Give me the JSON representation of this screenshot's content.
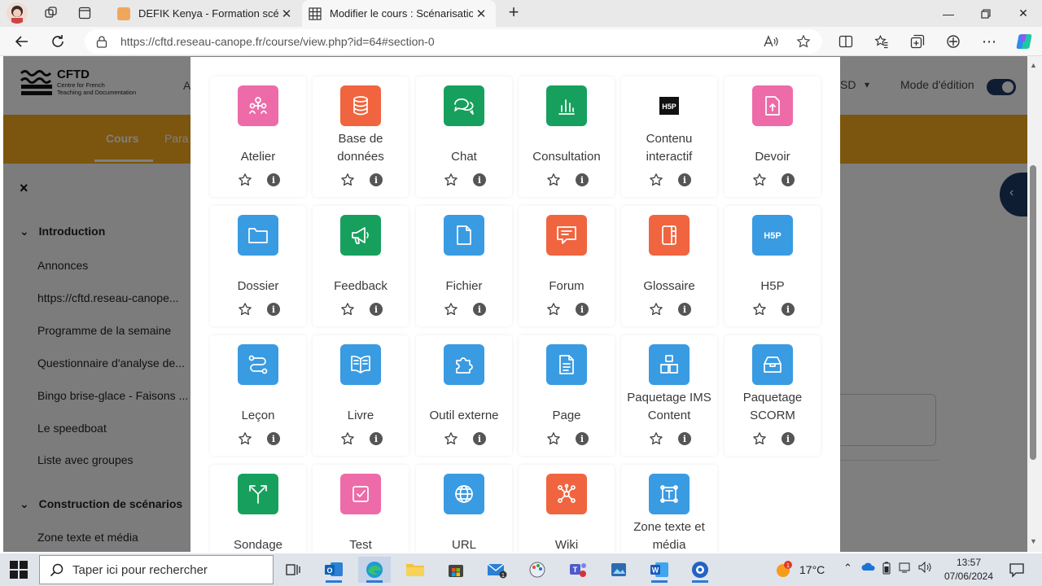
{
  "browser": {
    "tabs": [
      {
        "title": "DEFIK Kenya - Formation scénari"
      },
      {
        "title": "Modifier le cours : Scénarisation"
      }
    ],
    "url": "https://cftd.reseau-canope.fr/course/view.php?id=64#section-0"
  },
  "site": {
    "logo_title": "CFTD",
    "logo_sub1": "Centre for French",
    "logo_sub2": "Teaching and Documentation",
    "header_partial_a": "A",
    "header_partial_sd": "SD",
    "edit_mode_label": "Mode d'édition",
    "nav": {
      "cours": "Cours",
      "para": "Para"
    }
  },
  "sidebar": {
    "close": "×",
    "sections": [
      {
        "title": "Introduction",
        "items": [
          "Annonces",
          "https://cftd.reseau-canope...",
          "Programme de la semaine",
          "Questionnaire d'analyse de...",
          "Bingo brise-glace - Faisons ...",
          "Le speedboat",
          "Liste avec groupes"
        ]
      },
      {
        "title": "Construction de scénarios",
        "items": [
          "Zone texte et média"
        ]
      }
    ]
  },
  "activities": [
    {
      "name": "Atelier",
      "color": "#ed6ba9",
      "icon": "workshop-icon"
    },
    {
      "name": "Base de données",
      "color": "#f0643f",
      "icon": "database-icon"
    },
    {
      "name": "Chat",
      "color": "#17a05d",
      "icon": "chat-icon"
    },
    {
      "name": "Consultation",
      "color": "#17a05d",
      "icon": "bar-chart-icon"
    },
    {
      "name": "Contenu interactif",
      "color": "#ffffff",
      "icon": "h5p-dark-icon"
    },
    {
      "name": "Devoir",
      "color": "#ed6ba9",
      "icon": "assignment-upload-icon"
    },
    {
      "name": "Dossier",
      "color": "#399be2",
      "icon": "folder-icon"
    },
    {
      "name": "Feedback",
      "color": "#17a05d",
      "icon": "megaphone-icon"
    },
    {
      "name": "Fichier",
      "color": "#399be2",
      "icon": "file-icon"
    },
    {
      "name": "Forum",
      "color": "#f0643f",
      "icon": "forum-icon"
    },
    {
      "name": "Glossaire",
      "color": "#f0643f",
      "icon": "glossary-icon"
    },
    {
      "name": "H5P",
      "color": "#399be2",
      "icon": "h5p-icon"
    },
    {
      "name": "Leçon",
      "color": "#399be2",
      "icon": "lesson-icon"
    },
    {
      "name": "Livre",
      "color": "#399be2",
      "icon": "book-icon"
    },
    {
      "name": "Outil externe",
      "color": "#399be2",
      "icon": "puzzle-icon"
    },
    {
      "name": "Page",
      "color": "#399be2",
      "icon": "page-icon"
    },
    {
      "name": "Paquetage IMS Content",
      "color": "#399be2",
      "icon": "ims-package-icon"
    },
    {
      "name": "Paquetage SCORM",
      "color": "#399be2",
      "icon": "scorm-package-icon"
    },
    {
      "name": "Sondage",
      "color": "#17a05d",
      "icon": "choice-icon"
    },
    {
      "name": "Test",
      "color": "#ed6ba9",
      "icon": "quiz-icon"
    },
    {
      "name": "URL",
      "color": "#399be2",
      "icon": "globe-icon"
    },
    {
      "name": "Wiki",
      "color": "#f0643f",
      "icon": "wiki-icon"
    },
    {
      "name": "Zone texte et média",
      "color": "#399be2",
      "icon": "text-media-icon"
    }
  ],
  "info_glyph": "i",
  "taskbar": {
    "search_placeholder": "Taper ici pour rechercher",
    "temperature": "17°C",
    "time": "13:57",
    "date": "07/06/2024",
    "weather_badge": "1"
  }
}
